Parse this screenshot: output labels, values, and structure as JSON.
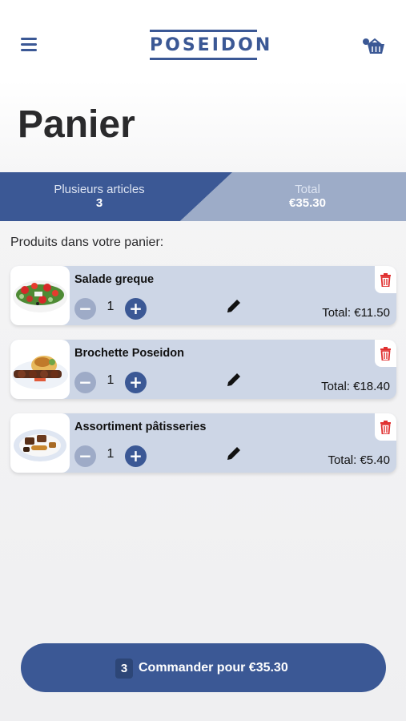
{
  "header": {
    "logo_text": "POSEIDON",
    "menu_icon": "hamburger-menu-icon",
    "cart_icon": "basket-icon",
    "brand_color": "#3b5895"
  },
  "page": {
    "title": "Panier"
  },
  "summary": {
    "items_label": "Plusieurs articles",
    "items_count": "3",
    "total_label": "Total",
    "total_value": "€35.30"
  },
  "cart": {
    "section_label": "Produits dans votre panier:",
    "items": [
      {
        "name": "Salade greque",
        "quantity": "1",
        "total": "Total: €11.50",
        "minus": "−",
        "plus": "+"
      },
      {
        "name": "Brochette Poseidon",
        "quantity": "1",
        "total": "Total: €18.40",
        "minus": "−",
        "plus": "+"
      },
      {
        "name": "Assortiment pâtisseries",
        "quantity": "1",
        "total": "Total: €5.40",
        "minus": "−",
        "plus": "+"
      }
    ]
  },
  "order_button": {
    "count": "3",
    "label": "Commander pour €35.30"
  },
  "colors": {
    "accent": "#3b5895",
    "light_accent": "#9dacc8",
    "card_bg": "#cdd6e6",
    "delete": "#e03030"
  }
}
